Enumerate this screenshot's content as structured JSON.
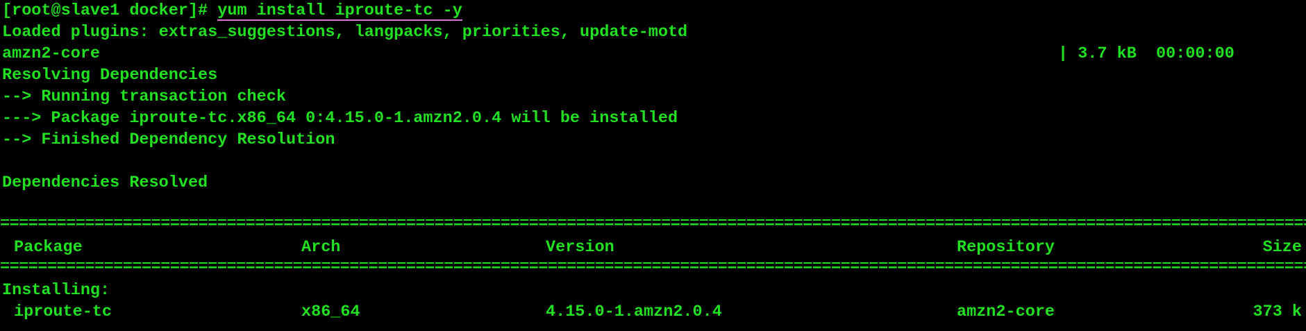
{
  "terminal": {
    "prompt": "[root@slave1 docker]# ",
    "command": "yum install iproute-tc -y",
    "lines": {
      "plugins": "Loaded plugins: extras_suggestions, langpacks, priorities, update-motd",
      "repo_name": "amzn2-core",
      "repo_stats": "| 3.7 kB  00:00:00",
      "resolving": "Resolving Dependencies",
      "check": "--> Running transaction check",
      "package_line": "---> Package iproute-tc.x86_64 0:4.15.0-1.amzn2.0.4 will be installed",
      "finished": "--> Finished Dependency Resolution",
      "resolved": "Dependencies Resolved"
    },
    "rule": "=============================================================================================================================================================================================",
    "table": {
      "headers": {
        "package": "Package",
        "arch": "Arch",
        "version": "Version",
        "repository": "Repository",
        "size": "Size"
      },
      "section": "Installing:",
      "row": {
        "package": "iproute-tc",
        "arch": "x86_64",
        "version": "4.15.0-1.amzn2.0.4",
        "repository": "amzn2-core",
        "size": "373 k"
      }
    }
  },
  "colors": {
    "text": "#22e022",
    "background": "#000000",
    "command_underline": "#d66fd6"
  }
}
